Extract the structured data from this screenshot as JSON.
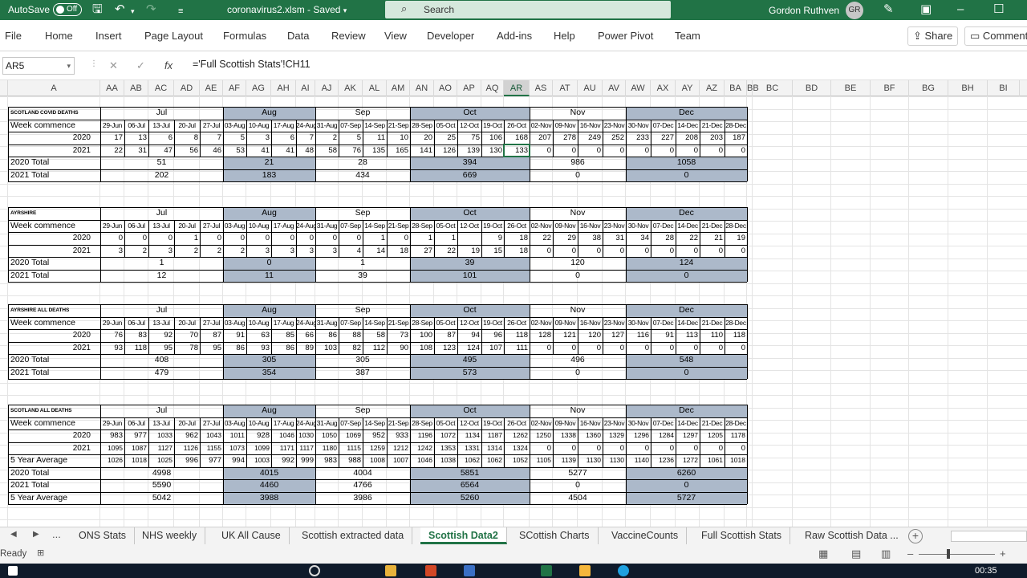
{
  "titlebar": {
    "autosave_label": "AutoSave",
    "autosave_state": "Off",
    "filename": "coronavirus2.xlsm",
    "saved_status": "Saved",
    "search_placeholder": "Search",
    "user_name": "Gordon Ruthven",
    "user_initials": "GR"
  },
  "menu": {
    "tabs": [
      "File",
      "Home",
      "Insert",
      "Page Layout",
      "Formulas",
      "Data",
      "Review",
      "View",
      "Developer",
      "Add-ins",
      "Help",
      "Power Pivot",
      "Team"
    ],
    "share_label": "Share",
    "comments_label": "Comments"
  },
  "formula_bar": {
    "name_box": "AR5",
    "formula": "='Full Scottish Stats'!CH11"
  },
  "columns": {
    "letters": [
      "A",
      "AA",
      "AB",
      "AC",
      "AD",
      "AE",
      "AF",
      "AG",
      "AH",
      "AI",
      "AJ",
      "AK",
      "AL",
      "AM",
      "AN",
      "AO",
      "AP",
      "AQ",
      "AR",
      "AS",
      "AT",
      "AU",
      "AV",
      "AW",
      "AX",
      "AY",
      "AZ",
      "BA",
      "BB",
      "BC",
      "BD",
      "BE",
      "BF",
      "BG",
      "BH",
      "BI"
    ],
    "selected": "AR"
  },
  "sheet": {
    "week_label": "Week commence",
    "months": [
      "Jul",
      "Aug",
      "Sep",
      "Oct",
      "Nov",
      "Dec"
    ],
    "weeks": [
      "29-Jun",
      "06-Jul",
      "13-Jul",
      "20-Jul",
      "27-Jul",
      "03-Aug",
      "10-Aug",
      "17-Aug",
      "24-Aug",
      "31-Aug",
      "07-Sep",
      "14-Sep",
      "21-Sep",
      "28-Sep",
      "05-Oct",
      "12-Oct",
      "19-Oct",
      "26-Oct",
      "02-Nov",
      "09-Nov",
      "16-Nov",
      "23-Nov",
      "30-Nov",
      "07-Dec",
      "14-Dec",
      "21-Dec",
      "28-Dec"
    ],
    "blocks": [
      {
        "title": "SCOTLAND COVID DEATHS",
        "rows": [
          {
            "label": "2020",
            "values": [
              "17",
              "13",
              "6",
              "8",
              "7",
              "5",
              "3",
              "6",
              "7",
              "2",
              "5",
              "11",
              "10",
              "20",
              "25",
              "75",
              "106",
              "168",
              "207",
              "278",
              "249",
              "252",
              "233",
              "227",
              "208",
              "203",
              "187"
            ]
          },
          {
            "label": "2021",
            "values": [
              "22",
              "31",
              "47",
              "56",
              "46",
              "53",
              "41",
              "41",
              "48",
              "58",
              "76",
              "135",
              "165",
              "141",
              "126",
              "139",
              "130",
              "133",
              "0",
              "0",
              "0",
              "0",
              "0",
              "0",
              "0",
              "0",
              "0"
            ]
          }
        ],
        "totals": [
          {
            "label": "2020 Total",
            "values": [
              "51",
              "21",
              "28",
              "394",
              "986",
              "1058"
            ]
          },
          {
            "label": "2021 Total",
            "values": [
              "202",
              "183",
              "434",
              "669",
              "0",
              "0"
            ]
          }
        ]
      },
      {
        "title": "AYRSHIRE",
        "rows": [
          {
            "label": "2020",
            "values": [
              "0",
              "0",
              "0",
              "1",
              "0",
              "0",
              "0",
              "0",
              "0",
              "0",
              "0",
              "1",
              "0",
              "1",
              "1",
              "",
              "9",
              "18",
              "22",
              "29",
              "38",
              "31",
              "34",
              "28",
              "22",
              "21",
              "19"
            ]
          },
          {
            "label": "2021",
            "values": [
              "3",
              "2",
              "3",
              "2",
              "2",
              "2",
              "3",
              "3",
              "3",
              "3",
              "4",
              "14",
              "18",
              "27",
              "22",
              "19",
              "15",
              "18",
              "0",
              "0",
              "0",
              "0",
              "0",
              "0",
              "0",
              "0",
              "0"
            ]
          }
        ],
        "totals": [
          {
            "label": "2020 Total",
            "values": [
              "1",
              "0",
              "1",
              "39",
              "120",
              "124"
            ]
          },
          {
            "label": "2021 Total",
            "values": [
              "12",
              "11",
              "39",
              "101",
              "0",
              "0"
            ]
          }
        ]
      },
      {
        "title": "AYRSHIRE ALL DEATHS",
        "rows": [
          {
            "label": "2020",
            "values": [
              "76",
              "83",
              "92",
              "70",
              "87",
              "91",
              "63",
              "85",
              "66",
              "86",
              "88",
              "58",
              "73",
              "100",
              "87",
              "94",
              "96",
              "118",
              "128",
              "121",
              "120",
              "127",
              "116",
              "91",
              "113",
              "110",
              "118"
            ]
          },
          {
            "label": "2021",
            "values": [
              "93",
              "118",
              "95",
              "78",
              "95",
              "86",
              "93",
              "86",
              "89",
              "103",
              "82",
              "112",
              "90",
              "108",
              "123",
              "124",
              "107",
              "111",
              "0",
              "0",
              "0",
              "0",
              "0",
              "0",
              "0",
              "0",
              "0"
            ]
          }
        ],
        "totals": [
          {
            "label": "2020 Total",
            "values": [
              "408",
              "305",
              "305",
              "495",
              "496",
              "548"
            ]
          },
          {
            "label": "2021 Total",
            "values": [
              "479",
              "354",
              "387",
              "573",
              "0",
              "0"
            ]
          }
        ]
      },
      {
        "title": "SCOTLAND ALL DEATHS",
        "rows": [
          {
            "label": "2020",
            "values": [
              "983",
              "977",
              "1033",
              "962",
              "1043",
              "1011",
              "928",
              "1046",
              "1030",
              "1050",
              "1069",
              "952",
              "933",
              "1196",
              "1072",
              "1134",
              "1187",
              "1262",
              "1250",
              "1338",
              "1360",
              "1329",
              "1296",
              "1284",
              "1297",
              "1205",
              "1178"
            ]
          },
          {
            "label": "2021",
            "values": [
              "1095",
              "1087",
              "1127",
              "1126",
              "1155",
              "1073",
              "1099",
              "1171",
              "1117",
              "1180",
              "1115",
              "1259",
              "1212",
              "1242",
              "1353",
              "1331",
              "1314",
              "1324",
              "0",
              "0",
              "0",
              "0",
              "0",
              "0",
              "0",
              "0",
              "0"
            ]
          },
          {
            "label": "5 Year Average",
            "values": [
              "1026",
              "1018",
              "1025",
              "996",
              "977",
              "994",
              "1003",
              "992",
              "999",
              "983",
              "988",
              "1008",
              "1007",
              "1046",
              "1038",
              "1062",
              "1062",
              "1052",
              "1105",
              "1139",
              "1130",
              "1130",
              "1140",
              "1236",
              "1272",
              "1061",
              "1018"
            ]
          }
        ],
        "totals": [
          {
            "label": "2020 Total",
            "values": [
              "4998",
              "4015",
              "4004",
              "5851",
              "5277",
              "6260"
            ]
          },
          {
            "label": "2021 Total",
            "values": [
              "5590",
              "4460",
              "4766",
              "6564",
              "0",
              "0"
            ]
          },
          {
            "label": "5 Year Average",
            "values": [
              "5042",
              "3988",
              "3986",
              "5260",
              "4504",
              "5727"
            ]
          }
        ]
      }
    ]
  },
  "sheet_tabs": {
    "overflow": "...",
    "tabs": [
      "ONS Stats",
      "NHS weekly",
      "UK All Cause",
      "Scottish extracted data",
      "Scottish Data2",
      "SCottish Charts",
      "VaccineCounts",
      "Full Scottish Stats",
      "Raw Scottish Data ..."
    ],
    "active": "Scottish Data2"
  },
  "status": {
    "text": "Ready"
  },
  "taskbar": {
    "time": "00:35"
  },
  "colors": {
    "excel_green": "#217346",
    "month_shade": "#acb9ca",
    "taskbar": "#0f1b2b"
  }
}
